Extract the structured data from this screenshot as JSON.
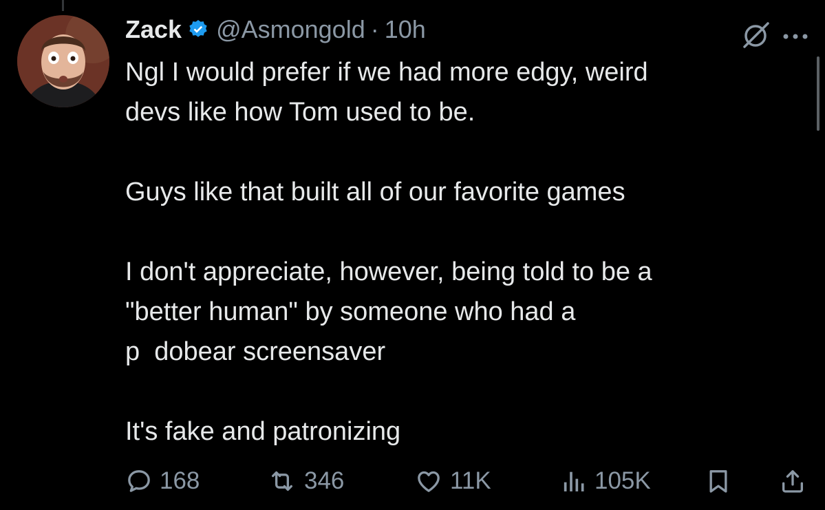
{
  "tweet": {
    "author": {
      "name": "Zack",
      "handle": "@Asmongold",
      "separator": "·",
      "time": "10h",
      "verified": true
    },
    "text": {
      "paragraphs": [
        [
          "Ngl I would prefer if we had more edgy, weird",
          "devs like how Tom used to be."
        ],
        [
          "Guys like that built all of our favorite games"
        ],
        [
          "I don't appreciate, however, being told to be a",
          "\"better human\" by someone who had a",
          "p  dobear screensaver"
        ],
        [
          "It's fake and patronizing"
        ]
      ]
    },
    "stats": {
      "replies": "168",
      "retweets": "346",
      "likes": "11K",
      "views": "105K"
    }
  },
  "icons": {
    "verified": "verified-badge-icon",
    "grok": "grok-icon",
    "more": "more-icon",
    "reply": "reply-icon",
    "retweet": "retweet-icon",
    "like": "heart-icon",
    "views": "views-icon",
    "bookmark": "bookmark-icon",
    "share": "share-icon"
  },
  "colors": {
    "background": "#000000",
    "text": "#e7e9ea",
    "secondary": "#8b98a5",
    "verified": "#1d9bf0"
  }
}
